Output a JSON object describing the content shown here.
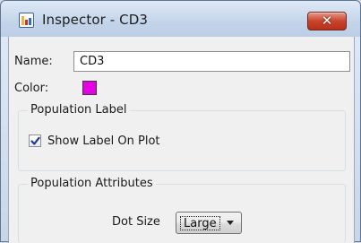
{
  "window": {
    "title": "Inspector - CD3",
    "close_label": "✕"
  },
  "fields": {
    "name_label": "Name:",
    "name_value": "CD3",
    "color_label": "Color:",
    "color_value": "#e600e6"
  },
  "population_label": {
    "title": "Population Label",
    "show_label_text": "Show Label On Plot",
    "show_label_checked": true
  },
  "population_attributes": {
    "title": "Population Attributes",
    "dot_size_label": "Dot Size",
    "dot_size_value": "Large"
  }
}
